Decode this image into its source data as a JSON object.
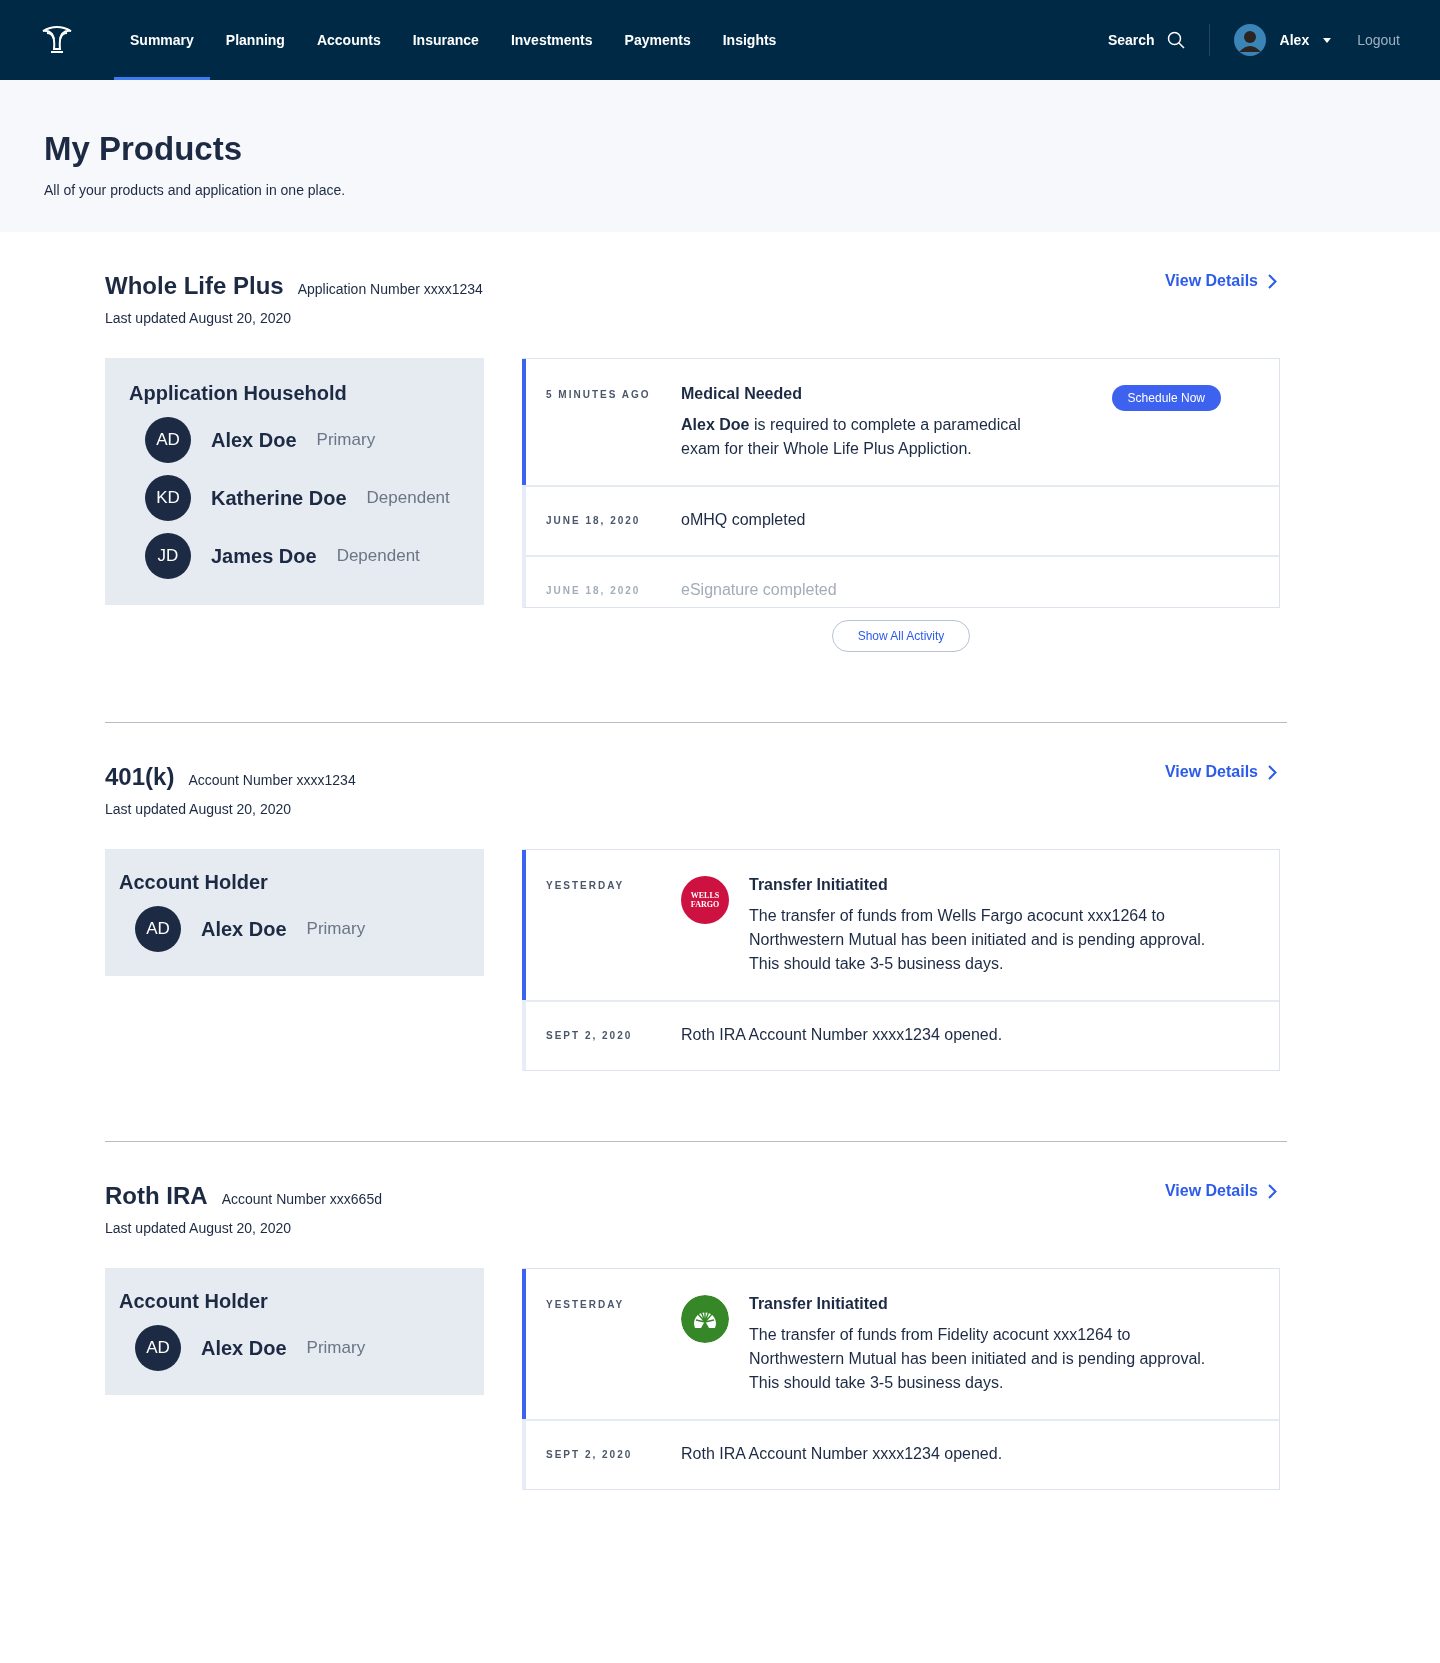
{
  "nav": {
    "tabs": [
      {
        "label": "Summary",
        "selected": true
      },
      {
        "label": "Planning",
        "selected": false
      },
      {
        "label": "Accounts",
        "selected": false
      },
      {
        "label": "Insurance",
        "selected": false
      },
      {
        "label": "Investments",
        "selected": false
      },
      {
        "label": "Payments",
        "selected": false
      },
      {
        "label": "Insights",
        "selected": false
      }
    ],
    "search": "Search",
    "user": "Alex",
    "logout": "Logout"
  },
  "hero": {
    "title": "My Products",
    "subtitle": "All of your products and application in one place."
  },
  "products": [
    {
      "name": "Whole Life Plus",
      "number": "Application Number xxxx1234",
      "updated": "Last updated August 20, 2020",
      "link": "View Details",
      "members_title": "Application Household",
      "members": [
        {
          "initials": "AD",
          "name": "Alex Doe",
          "role": "Primary"
        },
        {
          "initials": "KD",
          "name": "Katherine Doe",
          "role": "Dependent"
        },
        {
          "initials": "JD",
          "name": "James Doe",
          "role": "Dependent"
        }
      ],
      "activity": [
        {
          "kind": "alert",
          "highlighted": true,
          "faded": false,
          "date": "5 MINUTES AGO",
          "title": "Medical Needed",
          "body": "**Alex Doe** is required to complete a paramedical exam for their Whole Life Plus Appliction.",
          "button": "Schedule Now"
        },
        {
          "kind": "simple",
          "highlighted": false,
          "faded": false,
          "date": "JUNE 18, 2020",
          "text": "oMHQ completed"
        },
        {
          "kind": "simple",
          "highlighted": false,
          "faded": true,
          "date": "JUNE 18, 2020",
          "text": "eSignature completed"
        }
      ],
      "more": "Show All Activity"
    },
    {
      "name": "401(k)",
      "number": "Account Number xxxx1234",
      "updated": "Last updated August 20, 2020",
      "link": "View Details",
      "members_title": "Account Holder",
      "members": [
        {
          "initials": "AD",
          "name": "Alex Doe",
          "role": "Primary"
        }
      ],
      "activity": [
        {
          "kind": "transfer",
          "highlighted": true,
          "faded": false,
          "date": "YESTERDAY",
          "logo": {
            "kind": "wordmark",
            "text": "WELLS FARGO",
            "color": "#cd1241"
          },
          "title": "Transfer Initiatited",
          "body": "The transfer of funds from Wells Fargo acocunt xxx1264 to Northwestern Mutual has been initiated and is pending approval. This should take 3-5 business days."
        },
        {
          "kind": "simple",
          "highlighted": false,
          "faded": false,
          "date": "SEPT 2, 2020",
          "text": "Roth IRA Account Number xxxx1234 opened."
        }
      ]
    },
    {
      "name": "Roth IRA",
      "number": "Account Number xxx665d",
      "updated": "Last updated August 20, 2020",
      "link": "View Details",
      "members_title": "Account Holder",
      "members": [
        {
          "initials": "AD",
          "name": "Alex Doe",
          "role": "Primary"
        }
      ],
      "activity": [
        {
          "kind": "transfer",
          "highlighted": true,
          "faded": false,
          "date": "YESTERDAY",
          "logo": {
            "kind": "tree",
            "color": "#368727"
          },
          "title": "Transfer Initiatited",
          "body": "The transfer of funds from Fidelity acocunt xxx1264 to Northwestern Mutual has been initiated and is pending approval. This should take 3-5 business days."
        },
        {
          "kind": "simple",
          "highlighted": false,
          "faded": false,
          "date": "SEPT 2, 2020",
          "text": "Roth IRA Account Number xxxx1234 opened."
        }
      ]
    }
  ]
}
